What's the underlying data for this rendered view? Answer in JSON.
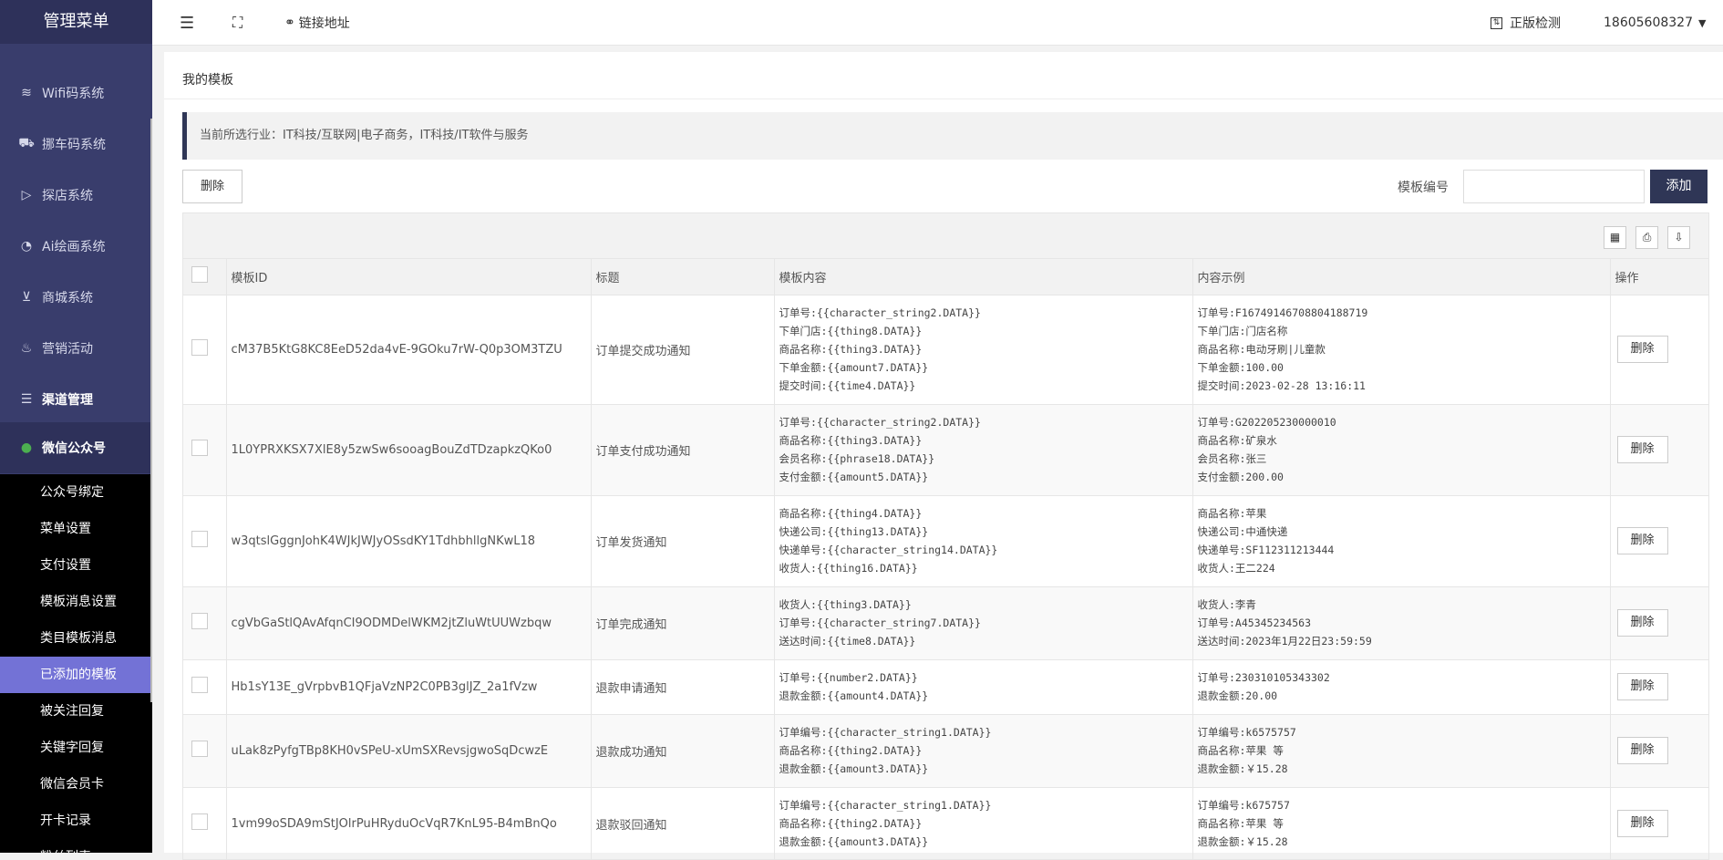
{
  "sidebar": {
    "title": "管理菜单",
    "items": [
      {
        "label": "Wifi码系统",
        "icon": "wifi-icon"
      },
      {
        "label": "挪车码系统",
        "icon": "car-icon"
      },
      {
        "label": "探店系统",
        "icon": "video-icon"
      },
      {
        "label": "Ai绘画系统",
        "icon": "palette-icon"
      },
      {
        "label": "商城系统",
        "icon": "cart-icon"
      },
      {
        "label": "营销活动",
        "icon": "fire-icon"
      },
      {
        "label": "渠道管理",
        "icon": "channel-icon"
      },
      {
        "label": "微信公众号",
        "icon": "wechat-icon"
      }
    ],
    "submenu": [
      "公众号绑定",
      "菜单设置",
      "支付设置",
      "模板消息设置",
      "类目模板消息",
      "已添加的模板",
      "被关注回复",
      "关键字回复",
      "微信会员卡",
      "开卡记录",
      "粉丝列表"
    ],
    "active_submenu": "已添加的模板"
  },
  "topbar": {
    "link_label": "链接地址",
    "license_label": "正版检测",
    "user": "18605608327"
  },
  "page": {
    "title": "我的模板",
    "industry_notice": "当前所选行业：IT科技/互联网|电子商务，IT科技/IT软件与服务",
    "delete_label": "删除",
    "template_no_label": "模板编号",
    "template_no_value": "",
    "add_label": "添加"
  },
  "table": {
    "headers": [
      "模板ID",
      "标题",
      "模板内容",
      "内容示例",
      "操作"
    ],
    "row_action": "删除",
    "rows": [
      {
        "id": "cM37B5KtG8KC8EeD52da4vE-9GOku7rW-Q0p3OM3TZU",
        "title": "订单提交成功通知",
        "content": [
          "订单号:{{character_string2.DATA}}",
          "下单门店:{{thing8.DATA}}",
          "商品名称:{{thing3.DATA}}",
          "下单金额:{{amount7.DATA}}",
          "提交时间:{{time4.DATA}}"
        ],
        "example": [
          "订单号:F16749146708804188719",
          "下单门店:门店名称",
          "商品名称:电动牙刷|儿童款",
          "下单金额:100.00",
          "提交时间:2023-02-28 13:16:11"
        ]
      },
      {
        "id": "1L0YPRXKSX7XlE8y5zwSw6sooagBouZdTDzapkzQKo0",
        "title": "订单支付成功通知",
        "content": [
          "订单号:{{character_string2.DATA}}",
          "商品名称:{{thing3.DATA}}",
          "会员名称:{{phrase18.DATA}}",
          "支付金额:{{amount5.DATA}}"
        ],
        "example": [
          "订单号:G202205230000010",
          "商品名称:矿泉水",
          "会员名称:张三",
          "支付金额:200.00"
        ]
      },
      {
        "id": "w3qtslGggnJohK4WJkJWJyOSsdKY1TdhbhllgNKwL18",
        "title": "订单发货通知",
        "content": [
          "商品名称:{{thing4.DATA}}",
          "快递公司:{{thing13.DATA}}",
          "快递单号:{{character_string14.DATA}}",
          "收货人:{{thing16.DATA}}"
        ],
        "example": [
          "商品名称:苹果",
          "快递公司:中通快递",
          "快递单号:SF112311213444",
          "收货人:王二224"
        ]
      },
      {
        "id": "cgVbGaStlQAvAfqnCI9ODMDelWKM2jtZluWtUUWzbqw",
        "title": "订单完成通知",
        "content": [
          "收货人:{{thing3.DATA}}",
          "订单号:{{character_string7.DATA}}",
          "送达时间:{{time8.DATA}}"
        ],
        "example": [
          "收货人:李青",
          "订单号:A45345234563",
          "送达时间:2023年1月22日23:59:59"
        ]
      },
      {
        "id": "Hb1sY13E_gVrpbvB1QFjaVzNP2C0PB3glJZ_2a1fVzw",
        "title": "退款申请通知",
        "content": [
          "订单号:{{number2.DATA}}",
          "退款金额:{{amount4.DATA}}"
        ],
        "example": [
          "订单号:230310105343302",
          "退款金额:20.00"
        ]
      },
      {
        "id": "uLak8zPyfgTBp8KH0vSPeU-xUmSXRevsjgwoSqDcwzE",
        "title": "退款成功通知",
        "content": [
          "订单编号:{{character_string1.DATA}}",
          "商品名称:{{thing2.DATA}}",
          "退款金额:{{amount3.DATA}}"
        ],
        "example": [
          "订单编号:k6575757",
          "商品名称:苹果 等",
          "退款金额:￥15.28"
        ]
      },
      {
        "id": "1vm99oSDA9mStJOlrPuHRyduOcVqR7KnL95-B4mBnQo",
        "title": "退款驳回通知",
        "content": [
          "订单编号:{{character_string1.DATA}}",
          "商品名称:{{thing2.DATA}}",
          "退款金额:{{amount3.DATA}}"
        ],
        "example": [
          "订单编号:k675757",
          "商品名称:苹果 等",
          "退款金额:￥15.28"
        ]
      }
    ]
  }
}
